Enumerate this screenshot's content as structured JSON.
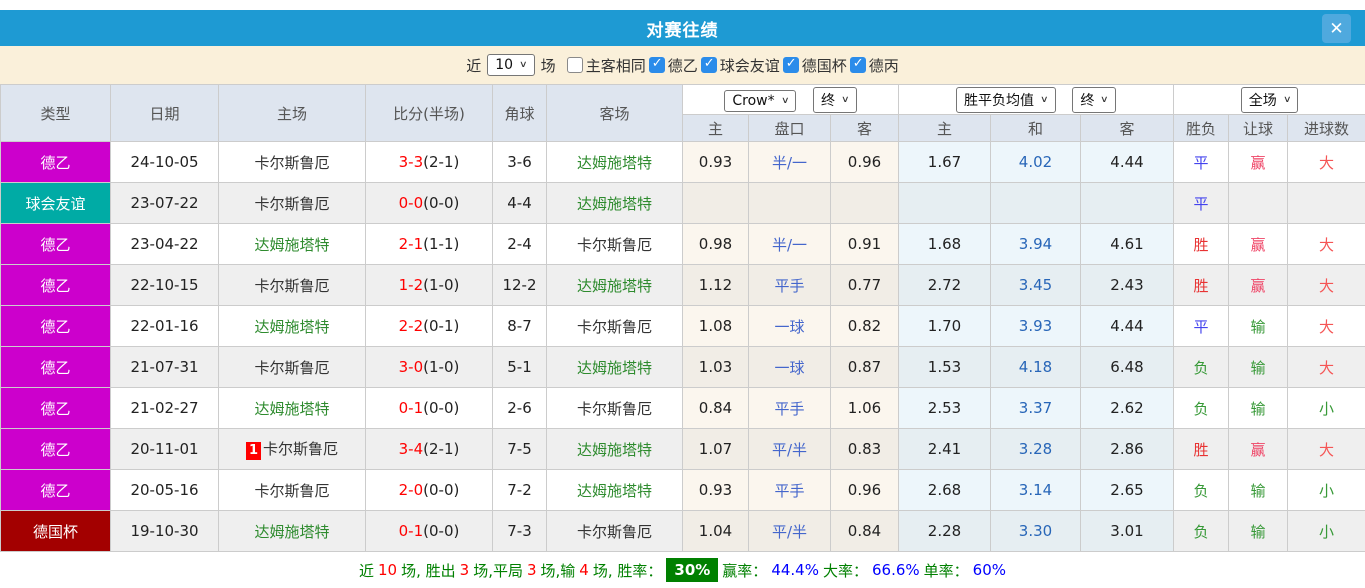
{
  "title_bar": {
    "title": "对赛往绩",
    "close_icon": "✕"
  },
  "filters": {
    "recent_label": "近",
    "count_value": "10",
    "matches_label": "场",
    "same_side_label": "主客相同",
    "same_side_checked": false,
    "leagues": [
      {
        "label": "德乙",
        "checked": true
      },
      {
        "label": "球会友谊",
        "checked": true
      },
      {
        "label": "德国杯",
        "checked": true
      },
      {
        "label": "德丙",
        "checked": true
      }
    ]
  },
  "table": {
    "main_headers": [
      "类型",
      "日期",
      "主场",
      "比分(半场)",
      "角球",
      "客场"
    ],
    "sub_headers": [
      "主",
      "盘口",
      "客",
      "主",
      "和",
      "客",
      "胜负",
      "让球",
      "进球数"
    ],
    "selects": {
      "bookmaker": "Crow*",
      "bookmaker_stage": "终",
      "avg": "胜平负均值",
      "avg_stage": "终",
      "scope": "全场"
    },
    "type_colors": {
      "德乙": "#CC00CC",
      "球会友谊": "#00ABA5",
      "德国杯": "#A30000"
    },
    "rows": [
      {
        "type": "德乙",
        "date": "24-10-05",
        "home": "卡尔斯鲁厄",
        "home_green": false,
        "badge": "",
        "score": "3-3",
        "half": "(2-1)",
        "corner": "3-6",
        "away": "达姆施塔特",
        "away_green": true,
        "crow_home": "0.93",
        "handicap": "半/一",
        "crow_away": "0.96",
        "avg_home": "1.67",
        "avg_draw": "4.02",
        "avg_away": "4.44",
        "result": "平",
        "handicap_result": "赢",
        "goals": "大"
      },
      {
        "type": "球会友谊",
        "date": "23-07-22",
        "home": "卡尔斯鲁厄",
        "home_green": false,
        "badge": "",
        "score": "0-0",
        "half": "(0-0)",
        "corner": "4-4",
        "away": "达姆施塔特",
        "away_green": true,
        "crow_home": "",
        "handicap": "",
        "crow_away": "",
        "avg_home": "",
        "avg_draw": "",
        "avg_away": "",
        "result": "平",
        "handicap_result": "",
        "goals": ""
      },
      {
        "type": "德乙",
        "date": "23-04-22",
        "home": "达姆施塔特",
        "home_green": true,
        "badge": "",
        "score": "2-1",
        "half": "(1-1)",
        "corner": "2-4",
        "away": "卡尔斯鲁厄",
        "away_green": false,
        "crow_home": "0.98",
        "handicap": "半/一",
        "crow_away": "0.91",
        "avg_home": "1.68",
        "avg_draw": "3.94",
        "avg_away": "4.61",
        "result": "胜",
        "handicap_result": "赢",
        "goals": "大"
      },
      {
        "type": "德乙",
        "date": "22-10-15",
        "home": "卡尔斯鲁厄",
        "home_green": false,
        "badge": "",
        "score": "1-2",
        "half": "(1-0)",
        "corner": "12-2",
        "away": "达姆施塔特",
        "away_green": true,
        "crow_home": "1.12",
        "handicap": "平手",
        "crow_away": "0.77",
        "avg_home": "2.72",
        "avg_draw": "3.45",
        "avg_away": "2.43",
        "result": "胜",
        "handicap_result": "赢",
        "goals": "大"
      },
      {
        "type": "德乙",
        "date": "22-01-16",
        "home": "达姆施塔特",
        "home_green": true,
        "badge": "",
        "score": "2-2",
        "half": "(0-1)",
        "corner": "8-7",
        "away": "卡尔斯鲁厄",
        "away_green": false,
        "crow_home": "1.08",
        "handicap": "一球",
        "crow_away": "0.82",
        "avg_home": "1.70",
        "avg_draw": "3.93",
        "avg_away": "4.44",
        "result": "平",
        "handicap_result": "输",
        "goals": "大"
      },
      {
        "type": "德乙",
        "date": "21-07-31",
        "home": "卡尔斯鲁厄",
        "home_green": false,
        "badge": "",
        "score": "3-0",
        "half": "(1-0)",
        "corner": "5-1",
        "away": "达姆施塔特",
        "away_green": true,
        "crow_home": "1.03",
        "handicap": "一球",
        "crow_away": "0.87",
        "avg_home": "1.53",
        "avg_draw": "4.18",
        "avg_away": "6.48",
        "result": "负",
        "handicap_result": "输",
        "goals": "大"
      },
      {
        "type": "德乙",
        "date": "21-02-27",
        "home": "达姆施塔特",
        "home_green": true,
        "badge": "",
        "score": "0-1",
        "half": "(0-0)",
        "corner": "2-6",
        "away": "卡尔斯鲁厄",
        "away_green": false,
        "crow_home": "0.84",
        "handicap": "平手",
        "crow_away": "1.06",
        "avg_home": "2.53",
        "avg_draw": "3.37",
        "avg_away": "2.62",
        "result": "负",
        "handicap_result": "输",
        "goals": "小"
      },
      {
        "type": "德乙",
        "date": "20-11-01",
        "home": "卡尔斯鲁厄",
        "home_green": false,
        "badge": "1",
        "score": "3-4",
        "half": "(2-1)",
        "corner": "7-5",
        "away": "达姆施塔特",
        "away_green": true,
        "crow_home": "1.07",
        "handicap": "平/半",
        "crow_away": "0.83",
        "avg_home": "2.41",
        "avg_draw": "3.28",
        "avg_away": "2.86",
        "result": "胜",
        "handicap_result": "赢",
        "goals": "大"
      },
      {
        "type": "德乙",
        "date": "20-05-16",
        "home": "卡尔斯鲁厄",
        "home_green": false,
        "badge": "",
        "score": "2-0",
        "half": "(0-0)",
        "corner": "7-2",
        "away": "达姆施塔特",
        "away_green": true,
        "crow_home": "0.93",
        "handicap": "平手",
        "crow_away": "0.96",
        "avg_home": "2.68",
        "avg_draw": "3.14",
        "avg_away": "2.65",
        "result": "负",
        "handicap_result": "输",
        "goals": "小"
      },
      {
        "type": "德国杯",
        "date": "19-10-30",
        "home": "达姆施塔特",
        "home_green": true,
        "badge": "",
        "score": "0-1",
        "half": "(0-0)",
        "corner": "7-3",
        "away": "卡尔斯鲁厄",
        "away_green": false,
        "crow_home": "1.04",
        "handicap": "平/半",
        "crow_away": "0.84",
        "avg_home": "2.28",
        "avg_draw": "3.30",
        "avg_away": "3.01",
        "result": "负",
        "handicap_result": "输",
        "goals": "小"
      }
    ]
  },
  "footer": {
    "lead": "近",
    "total": "10",
    "wins_label": "场, 胜出",
    "wins": "3",
    "draws_label": "场,平局",
    "draws": "3",
    "losses_label": "场,输",
    "losses": "4",
    "rate_label": "场, 胜率：",
    "win_rate": "30%",
    "odds_win_label": "赢率：",
    "odds_win": "44.4%",
    "big_label": "大率：",
    "big_rate": "66.6%",
    "single_label": "单率：",
    "single_rate": "60%"
  }
}
